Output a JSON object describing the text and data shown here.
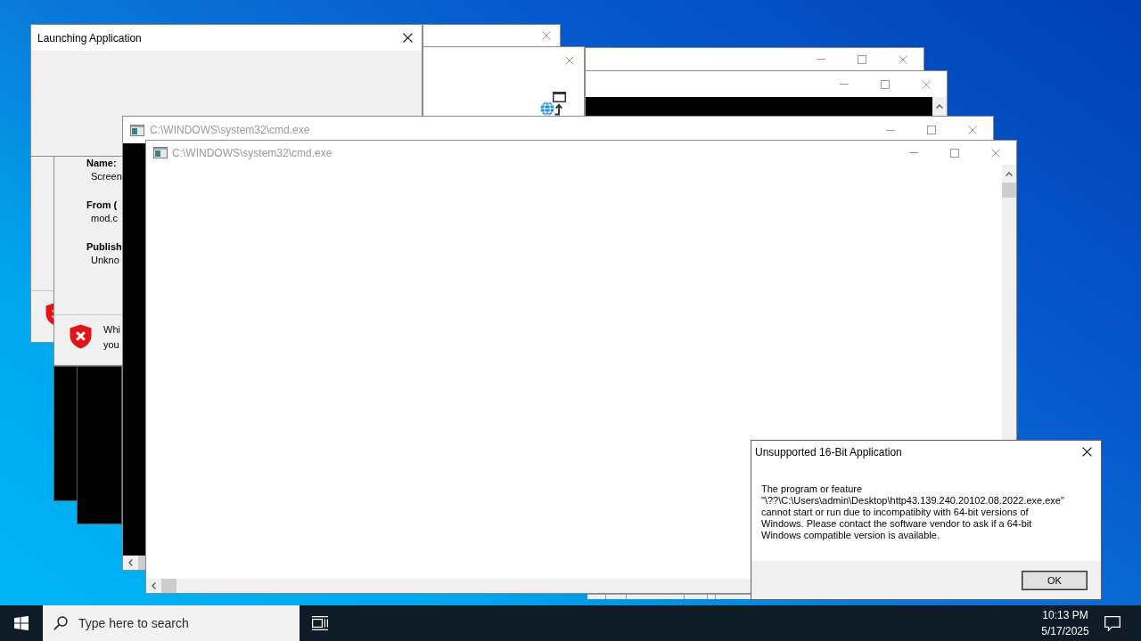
{
  "windows": [
    {
      "kind": "progress_dialog",
      "title": "Launching Application",
      "active": true
    },
    {
      "kind": "blank_window",
      "active": false
    },
    {
      "kind": "icon_dialog",
      "active": false
    },
    {
      "kind": "window_frame",
      "active": false
    },
    {
      "kind": "console_frame",
      "active": false
    },
    {
      "kind": "console",
      "title": "C:\\WINDOWS\\system32\\cmd.exe",
      "active": false,
      "painted": true
    },
    {
      "kind": "console",
      "title": "C:\\WINDOWS\\system32\\cmd.exe",
      "active": false,
      "painted": false
    },
    {
      "kind": "dialog_edge"
    },
    {
      "kind": "security_warning",
      "fields": [
        {
          "label": "Name:",
          "value": "Screen"
        },
        {
          "label": "From (",
          "value": "mod.c"
        },
        {
          "label": "Publish",
          "value": "Unkno"
        }
      ],
      "warning_lines": [
        "Whi",
        "you"
      ]
    },
    {
      "kind": "console_edge"
    },
    {
      "kind": "console_edge"
    },
    {
      "kind": "message_box",
      "title": "Unsupported 16-Bit Application",
      "active": true,
      "message_lines": [
        "The program or feature",
        "\"\\??\\C:\\Users\\admin\\Desktop\\http43.139.240.20102.08.2022.exe.exe\"",
        "cannot start or run due to incompatibity with 64-bit versions of",
        "Windows. Please contact the software vendor to ask if a 64-bit",
        "Windows compatible version is available."
      ],
      "buttons": [
        "OK"
      ]
    },
    {
      "kind": "window_edge"
    }
  ],
  "taskbar": {
    "search": {
      "placeholder": "Type here to search"
    },
    "clock": {
      "time": "10:13 PM",
      "date": "5/17/2025"
    }
  }
}
